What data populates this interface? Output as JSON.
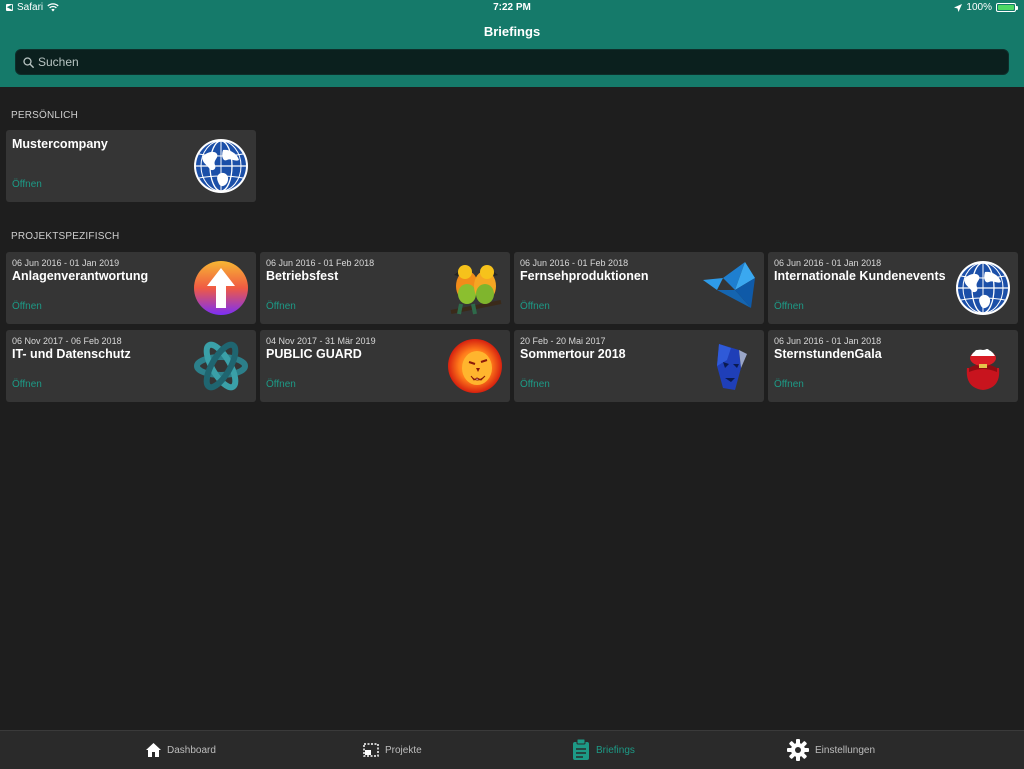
{
  "status_bar": {
    "app": "Safari",
    "time": "7:22 PM",
    "battery": "100%",
    "battery_level": 1.0
  },
  "header": {
    "title": "Briefings",
    "search_placeholder": "Suchen"
  },
  "colors": {
    "accent": "#1d9a86",
    "header": "#157a6a",
    "background": "#1e1e1e",
    "card": "#353535"
  },
  "sections": {
    "personal": {
      "title": "PERSÖNLICH",
      "cards": [
        {
          "name": "Mustercompany",
          "open": "Öffnen",
          "icon": "globe-icon"
        }
      ]
    },
    "project": {
      "title": "PROJEKTSPEZIFISCH",
      "cards": [
        {
          "date": "06 Jun 2016 - 01 Jan 2019",
          "name": "Anlagenverantwortung",
          "open": "Öffnen",
          "icon": "arrow-up-circle-icon"
        },
        {
          "date": "06 Jun 2016 - 01 Feb 2018",
          "name": "Betriebsfest",
          "open": "Öffnen",
          "icon": "parrots-icon"
        },
        {
          "date": "06 Jun 2016 - 01 Feb 2018",
          "name": "Fernsehproduktionen",
          "open": "Öffnen",
          "icon": "origami-bird-icon"
        },
        {
          "date": "06 Jun 2016 - 01 Jan 2018",
          "name": "Internationale Kundenevents",
          "open": "Öffnen",
          "icon": "globe-icon"
        },
        {
          "date": "06 Nov 2017 - 06 Feb 2018",
          "name": "IT- und Datenschutz",
          "open": "Öffnen",
          "icon": "knot-icon"
        },
        {
          "date": "04 Nov 2017 - 31 Mär 2019",
          "name": "PUBLIC GUARD",
          "open": "Öffnen",
          "icon": "lion-icon"
        },
        {
          "date": "20 Feb - 20 Mai 2017",
          "name": "Sommertour 2018",
          "open": "Öffnen",
          "icon": "mask-icon"
        },
        {
          "date": "06 Jun 2016 - 01 Jan 2018",
          "name": "SternstundenGala",
          "open": "Öffnen",
          "icon": "gift-sack-icon"
        }
      ]
    }
  },
  "tabbar": {
    "tabs": [
      {
        "label": "Dashboard",
        "icon": "home-icon",
        "active": false
      },
      {
        "label": "Projekte",
        "icon": "projects-icon",
        "active": false
      },
      {
        "label": "Briefings",
        "icon": "clipboard-icon",
        "active": true
      },
      {
        "label": "Einstellungen",
        "icon": "gear-icon",
        "active": false
      }
    ]
  }
}
